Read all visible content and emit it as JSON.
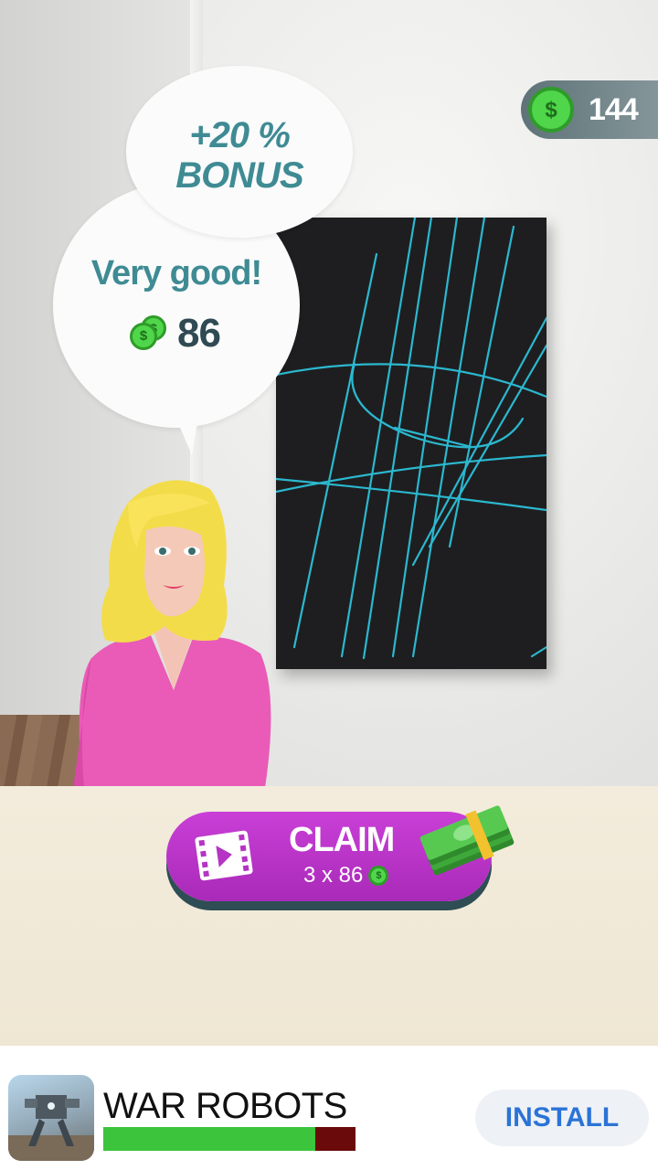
{
  "hud": {
    "balance": "144",
    "coin_symbol": "$"
  },
  "bonus_bubble": {
    "line1": "+20 %",
    "line2": "BONUS"
  },
  "result_bubble": {
    "message": "Very good!",
    "reward": "86",
    "coin_symbol": "$"
  },
  "claim_button": {
    "label": "CLAIM",
    "multiplier_text": "3 x 86",
    "coin_symbol": "$",
    "icon": "video-film-icon",
    "color": "#b534c4"
  },
  "ad_banner": {
    "title": "WAR ROBOTS",
    "install_label": "INSTALL",
    "progress": 0.84,
    "app_icon": "war-robots-app-icon"
  },
  "colors": {
    "accent_text": "#3f8b94",
    "coin_green": "#4fd64a",
    "drawing_stroke": "#2bb8cf",
    "panel": "#f1eadb"
  }
}
